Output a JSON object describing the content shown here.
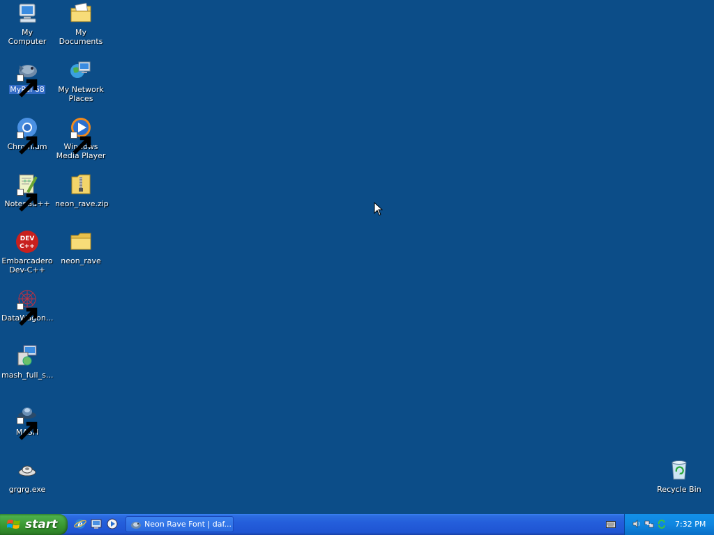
{
  "desktop": {
    "icons": [
      {
        "label": "My Computer",
        "icon": "my-computer-icon"
      },
      {
        "label": "My Documents",
        "icon": "my-documents-icon"
      },
      {
        "label": "MyPal 68",
        "icon": "mypal-icon",
        "selected": true
      },
      {
        "label": "My Network Places",
        "icon": "network-places-icon"
      },
      {
        "label": "Chromium",
        "icon": "chromium-icon"
      },
      {
        "label": "Windows Media Player",
        "icon": "media-player-icon"
      },
      {
        "label": "Notepad++",
        "icon": "notepad-plus-plus-icon"
      },
      {
        "label": "neon_rave.zip",
        "icon": "zip-folder-icon"
      },
      {
        "label": "Embarcadero Dev-C++",
        "icon": "dev-cpp-icon"
      },
      {
        "label": "neon_rave",
        "icon": "folder-icon"
      },
      {
        "label": "DataWagon...",
        "icon": "datawagon-icon"
      },
      {
        "label": "mash_full_s...",
        "icon": "installer-icon"
      },
      {
        "label": "MASH",
        "icon": "mash-icon"
      },
      {
        "label": "grgrg.exe",
        "icon": "exe-icon"
      },
      {
        "label": "Recycle Bin",
        "icon": "recycle-bin-icon"
      }
    ]
  },
  "taskbar": {
    "start_label": "start",
    "task_button_label": "Neon Rave Font | daf...",
    "clock": "7:32 PM"
  },
  "colors": {
    "desktop_bg": "#0c4d88",
    "taskbar_blue": "#245edb",
    "start_green": "#37952f",
    "tray_blue": "#0f86e0",
    "selection": "#316ac5"
  }
}
